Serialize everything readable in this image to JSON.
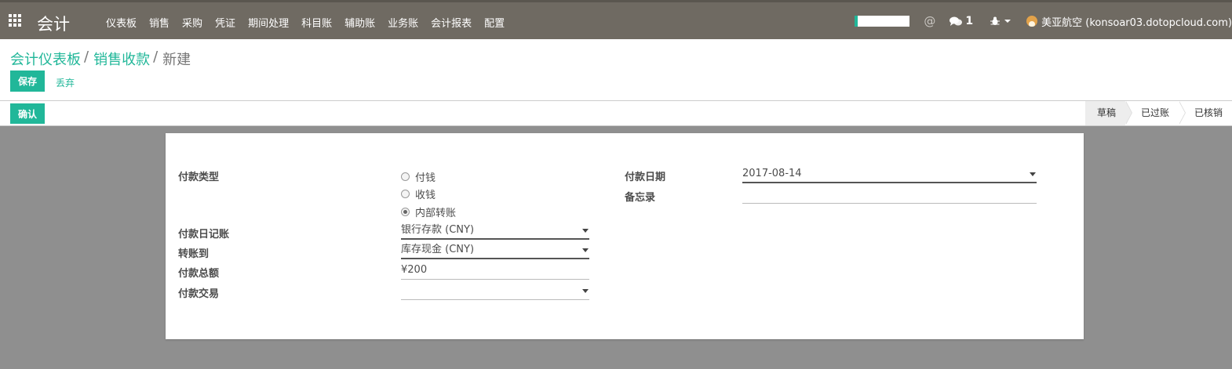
{
  "navbar": {
    "app_title": "会计",
    "menu": [
      "仪表板",
      "销售",
      "采购",
      "凭证",
      "期间处理",
      "科目账",
      "辅助账",
      "业务账",
      "会计报表",
      "配置"
    ],
    "message_count": "1",
    "at_symbol": "@",
    "user": "美亚航空 (konsoar03.dotopcloud.com)",
    "accent_color": "#21b799"
  },
  "breadcrumb": {
    "items": [
      "会计仪表板",
      "销售收款"
    ],
    "separator": "/",
    "current": "新建"
  },
  "actions": {
    "save": "保存",
    "discard": "丢弃",
    "confirm": "确认"
  },
  "stages": [
    "草稿",
    "已过账",
    "已核销"
  ],
  "form": {
    "payment_type": {
      "label": "付款类型",
      "options": [
        "付钱",
        "收钱",
        "内部转账"
      ],
      "selected": "内部转账"
    },
    "journal": {
      "label": "付款日记账",
      "value": "银行存款 (CNY)"
    },
    "transfer_to": {
      "label": "转账到",
      "value": "库存现金 (CNY)"
    },
    "amount": {
      "label": "付款总额",
      "value": "¥200"
    },
    "transaction": {
      "label": "付款交易",
      "value": ""
    },
    "payment_date": {
      "label": "付款日期",
      "value": "2017-08-14"
    },
    "memo": {
      "label": "备忘录",
      "value": ""
    }
  }
}
